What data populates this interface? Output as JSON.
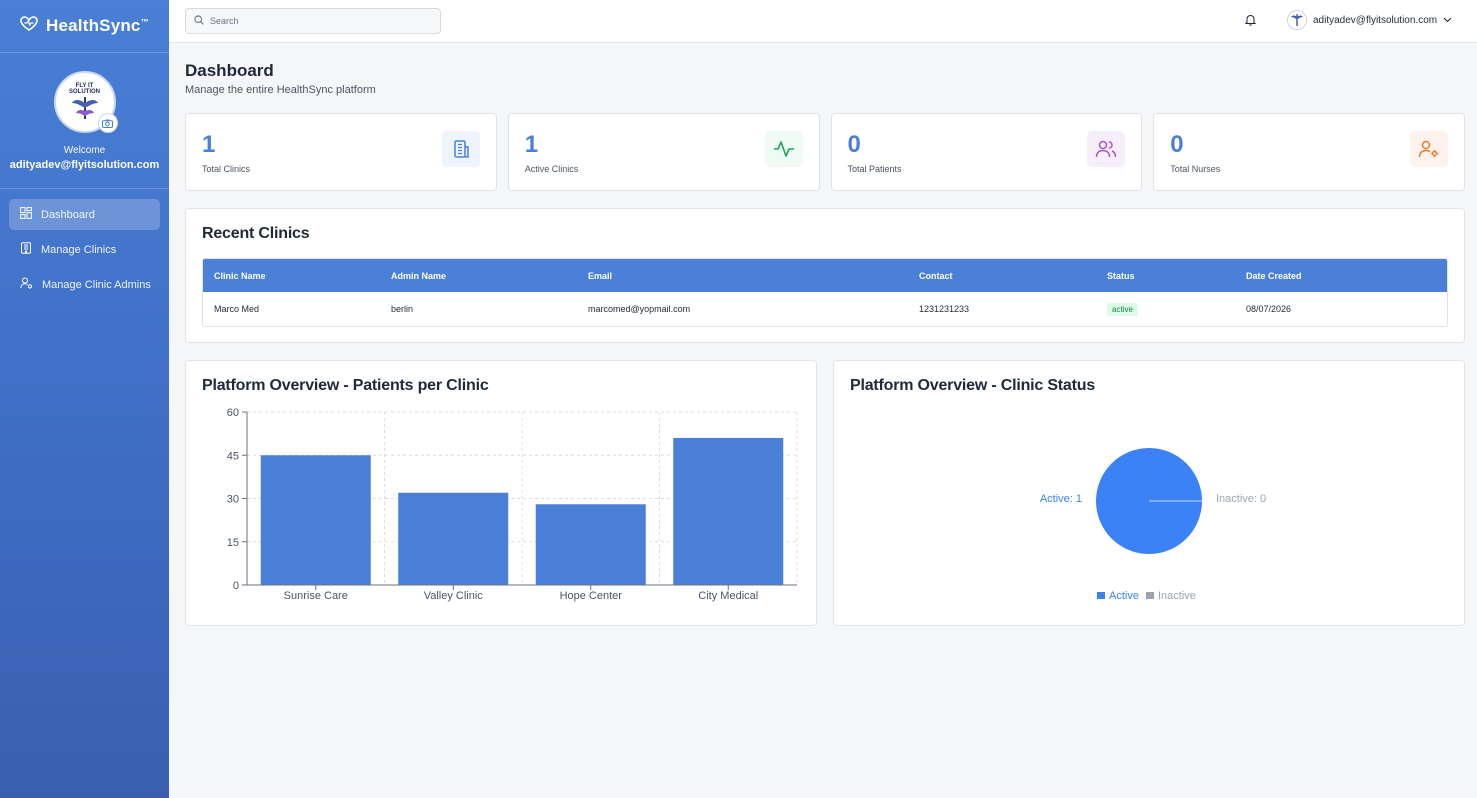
{
  "brand": {
    "name": "HealthSync",
    "tm": "™"
  },
  "profile": {
    "avatar_text": [
      "FLY IT",
      "SOLUTION"
    ],
    "welcome": "Welcome",
    "email": "adityadev@flyitsolution.com"
  },
  "nav": [
    {
      "label": "Dashboard",
      "icon": "grid-icon",
      "active": true
    },
    {
      "label": "Manage Clinics",
      "icon": "building-icon",
      "active": false
    },
    {
      "label": "Manage Clinic Admins",
      "icon": "user-cog-icon",
      "active": false
    }
  ],
  "topbar": {
    "search_placeholder": "Search",
    "user_email": "adityadev@flyitsolution.com"
  },
  "page": {
    "title": "Dashboard",
    "subtitle": "Manage the entire HealthSync platform"
  },
  "stats": [
    {
      "value": "1",
      "label": "Total Clinics",
      "icon": "building-icon",
      "icon_bg": "#eef4fd",
      "icon_color": "#4a80d8"
    },
    {
      "value": "1",
      "label": "Active Clinics",
      "icon": "activity-icon",
      "icon_bg": "#eefaf3",
      "icon_color": "#22a35a"
    },
    {
      "value": "0",
      "label": "Total Patients",
      "icon": "users-icon",
      "icon_bg": "#f7eefb",
      "icon_color": "#a855c7"
    },
    {
      "value": "0",
      "label": "Total Nurses",
      "icon": "user-gear-icon",
      "icon_bg": "#fdf3ec",
      "icon_color": "#ea7a2a"
    }
  ],
  "recent": {
    "title": "Recent Clinics",
    "columns": [
      "Clinic Name",
      "Admin Name",
      "Email",
      "Contact",
      "Status",
      "Date Created"
    ],
    "rows": [
      {
        "clinic": "Marco Med",
        "admin": "berlin",
        "email": "marcomed@yopmail.com",
        "contact": "1231231233",
        "status": "active",
        "date": "08/07/2026"
      }
    ]
  },
  "chart_data": [
    {
      "type": "bar",
      "title": "Platform Overview - Patients per Clinic",
      "categories": [
        "Sunrise Care",
        "Valley Clinic",
        "Hope Center",
        "City Medical"
      ],
      "values": [
        45,
        32,
        28,
        51
      ],
      "ylim": [
        0,
        60
      ],
      "yticks": [
        0,
        15,
        30,
        45,
        60
      ],
      "grid": true,
      "color": "#4a80d8"
    },
    {
      "type": "pie",
      "title": "Platform Overview - Clinic Status",
      "labels": [
        "Active",
        "Inactive"
      ],
      "values": [
        1,
        0
      ],
      "slice_labels": [
        "Active: 1",
        "Inactive: 0"
      ],
      "colors": [
        "#3b82f6",
        "#9ca3af"
      ],
      "legend": "bottom"
    }
  ],
  "colors": {
    "accent": "#4a80d8",
    "sidebar": "#4a7fd6"
  }
}
